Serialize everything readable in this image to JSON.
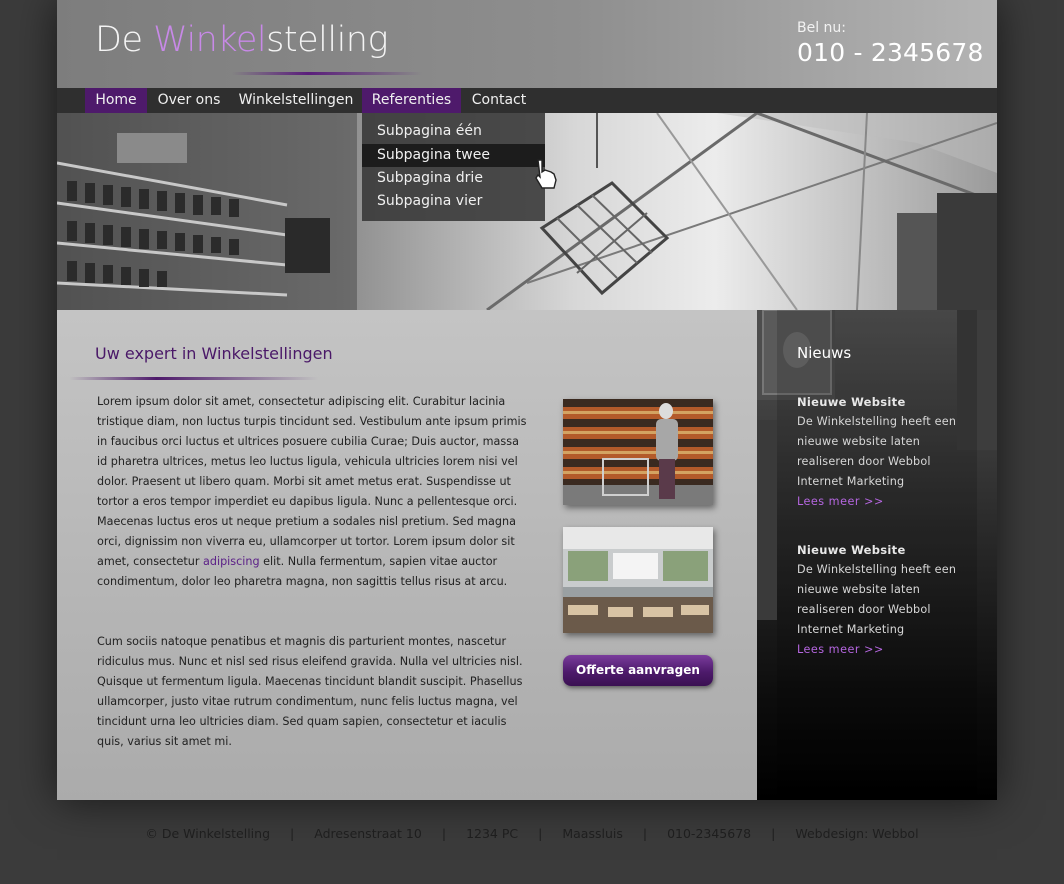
{
  "header": {
    "logo_part1": "De ",
    "logo_accent": "Winkel",
    "logo_part2": "stelling",
    "phone_label": "Bel nu:",
    "phone_number": "010 - 2345678"
  },
  "nav": {
    "items": [
      "Home",
      "Over ons",
      "Winkelstellingen",
      "Referenties",
      "Contact"
    ],
    "active": "Home",
    "highlighted": "Referenties"
  },
  "dropdown": {
    "items": [
      "Subpagina één",
      "Subpagina twee",
      "Subpagina drie",
      "Subpagina vier"
    ],
    "hovered": "Subpagina twee"
  },
  "main": {
    "title": "Uw expert in Winkelstellingen",
    "paragraph1_a": "Lorem ipsum dolor sit amet, consectetur adipiscing elit. Curabitur lacinia tristique diam, non luctus turpis tincidunt sed. Vestibulum ante ipsum primis in faucibus orci luctus et ultrices posuere cubilia Curae; Duis auctor, massa id pharetra ultrices, metus leo luctus ligula, vehicula ultricies lorem nisi vel dolor. Praesent ut libero quam. Morbi sit amet metus erat. Suspendisse ut tortor a eros tempor imperdiet eu dapibus ligula. Nunc a pellentesque orci. Maecenas luctus eros ut neque pretium a sodales nisl pretium. Sed magna orci, dignissim non viverra eu, ullamcorper ut tortor. Lorem ipsum dolor sit amet, consectetur ",
    "paragraph1_link": "adipiscing",
    "paragraph1_b": " elit. Nulla fermentum, sapien vitae auctor condimentum, dolor leo pharetra magna, non sagittis tellus risus at arcu.",
    "paragraph2": "Cum sociis natoque penatibus et magnis dis parturient montes, nascetur ridiculus mus. Nunc et nisl sed risus eleifend gravida. Nulla vel ultricies nisl. Quisque ut fermentum ligula. Maecenas tincidunt blandit suscipit. Phasellus ullamcorper, justo vitae rutrum condimentum, nunc felis luctus magna, vel tincidunt urna leo ultricies diam. Sed quam sapien, consectetur et iaculis quis, varius sit amet mi.",
    "button_label": "Offerte aanvragen"
  },
  "sidebar": {
    "title": "Nieuws",
    "news": [
      {
        "heading": "Nieuwe Website",
        "text": "De Winkelstelling heeft een nieuwe website laten realiseren door Webbol Internet Marketing",
        "link": "Lees meer >>"
      },
      {
        "heading": "Nieuwe Website",
        "text": "De Winkelstelling heeft een nieuwe website laten realiseren door Webbol Internet Marketing",
        "link": "Lees meer >>"
      }
    ]
  },
  "footer": {
    "items": [
      "© De Winkelstelling",
      "Adresenstraat 10",
      "1234 PC",
      "Maassluis",
      "010-2345678",
      "Webdesign: Webbol"
    ],
    "separator": "|"
  },
  "colors": {
    "accent_purple": "#4e1a6b",
    "logo_accent": "#c889e8",
    "link_purple": "#b566e0",
    "nav_bg": "#2f2f2f",
    "body_bg": "#3b3b3b"
  }
}
